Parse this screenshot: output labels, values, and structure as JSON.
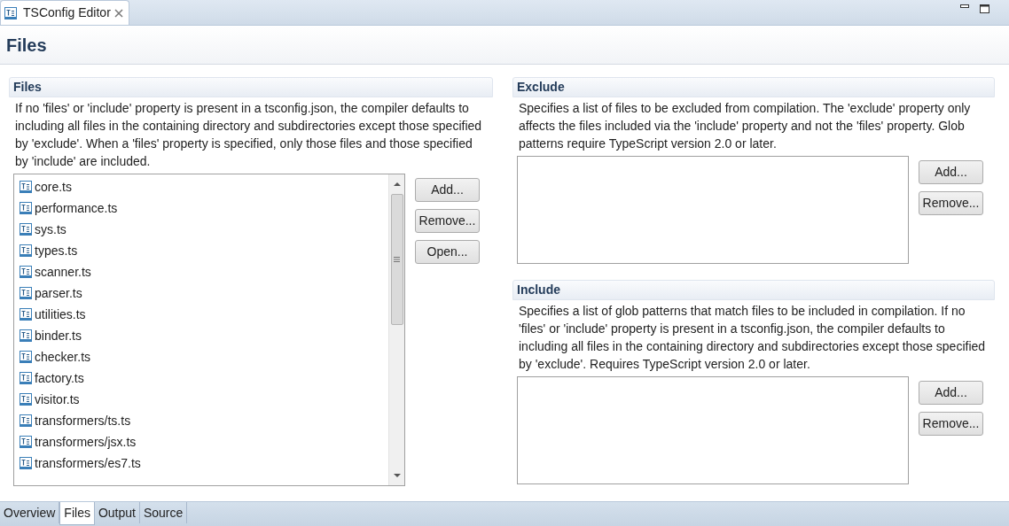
{
  "editor_tab": {
    "title": "TSConfig Editor"
  },
  "page_title": "Files",
  "files_section": {
    "title": "Files",
    "description": "If no 'files' or 'include' property is present in a tsconfig.json, the compiler defaults to including all files in the containing directory and subdirectories except those specified by 'exclude'. When a 'files' property is specified, only those files and those specified by 'include' are included.",
    "items": [
      "core.ts",
      "performance.ts",
      "sys.ts",
      "types.ts",
      "scanner.ts",
      "parser.ts",
      "utilities.ts",
      "binder.ts",
      "checker.ts",
      "factory.ts",
      "visitor.ts",
      "transformers/ts.ts",
      "transformers/jsx.ts",
      "transformers/es7.ts"
    ],
    "buttons": [
      "Add...",
      "Remove...",
      "Open..."
    ]
  },
  "exclude_section": {
    "title": "Exclude",
    "description": "Specifies a list of files to be excluded from compilation. The 'exclude' property only affects the files included via the 'include' property and not the 'files' property. Glob patterns require TypeScript version 2.0 or later.",
    "buttons": [
      "Add...",
      "Remove..."
    ]
  },
  "include_section": {
    "title": "Include",
    "description": "Specifies a list of glob patterns that match files to be included in compilation. If no 'files' or 'include' property is present in a tsconfig.json, the compiler defaults to including all files in the containing directory and subdirectories except those specified by 'exclude'. Requires TypeScript version 2.0 or later.",
    "buttons": [
      "Add...",
      "Remove..."
    ]
  },
  "bottom_tabs": [
    {
      "label": "Overview",
      "selected": false
    },
    {
      "label": "Files",
      "selected": true
    },
    {
      "label": "Output",
      "selected": false
    },
    {
      "label": "Source",
      "selected": false
    }
  ]
}
